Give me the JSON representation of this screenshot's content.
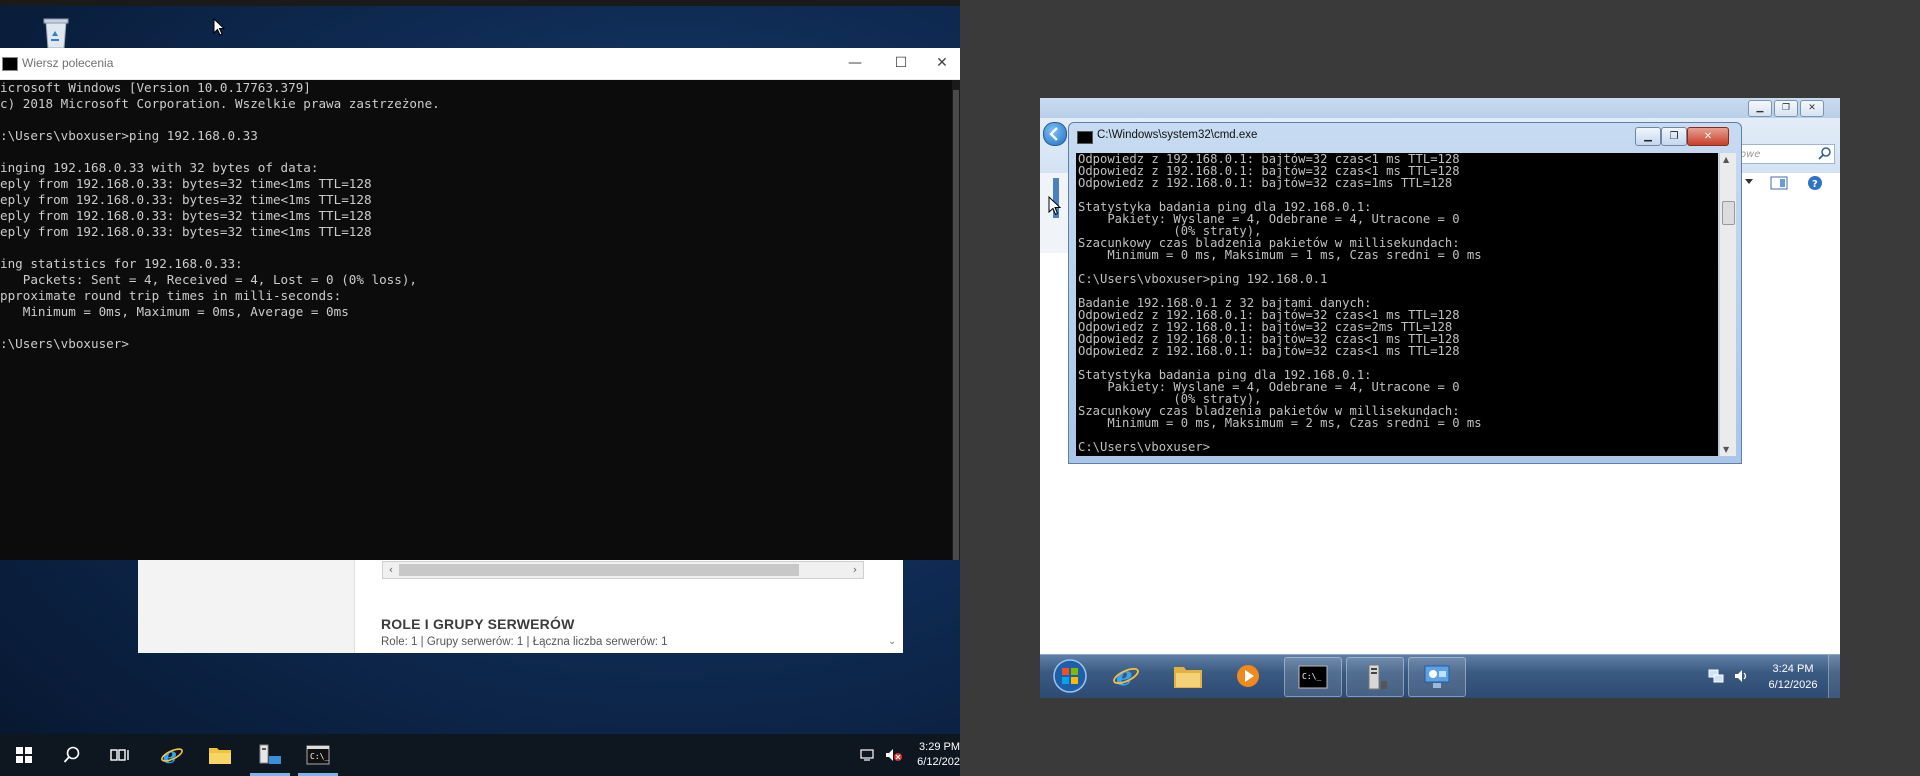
{
  "left_vm": {
    "cmd": {
      "title": "Wiersz polecenia",
      "lines": [
        "icrosoft Windows [Version 10.0.17763.379]",
        "c) 2018 Microsoft Corporation. Wszelkie prawa zastrzeżone.",
        "",
        ":\\Users\\vboxuser>ping 192.168.0.33",
        "",
        "inging 192.168.0.33 with 32 bytes of data:",
        "eply from 192.168.0.33: bytes=32 time<1ms TTL=128",
        "eply from 192.168.0.33: bytes=32 time<1ms TTL=128",
        "eply from 192.168.0.33: bytes=32 time<1ms TTL=128",
        "eply from 192.168.0.33: bytes=32 time<1ms TTL=128",
        "",
        "ing statistics for 192.168.0.33:",
        "   Packets: Sent = 4, Received = 4, Lost = 0 (0% loss),",
        "pproximate round trip times in milli-seconds:",
        "   Minimum = 0ms, Maximum = 0ms, Average = 0ms",
        "",
        ":\\Users\\vboxuser>"
      ],
      "btn_minimize": "—",
      "btn_maximize": "☐",
      "btn_close": "✕"
    },
    "server_manager": {
      "section_title": "ROLE I GRUPY SERWERÓW",
      "section_sub": "Role: 1 | Grupy serwerów: 1 | Łączna liczba serwerów: 1",
      "scroll_left": "‹",
      "scroll_right": "›",
      "chevron": "⌄"
    },
    "taskbar": {
      "time": "3:29 PM",
      "date": "6/12/202"
    }
  },
  "right_vm": {
    "explorer": {
      "search_placeholder": "owe"
    },
    "cmd": {
      "title": "C:\\Windows\\system32\\cmd.exe",
      "lines": [
        "Odpowiedz z 192.168.0.1: bajtów=32 czas<1 ms TTL=128",
        "Odpowiedz z 192.168.0.1: bajtów=32 czas<1 ms TTL=128",
        "Odpowiedz z 192.168.0.1: bajtów=32 czas=1ms TTL=128",
        "",
        "Statystyka badania ping dla 192.168.0.1:",
        "    Pakiety: Wyslane = 4, Odebrane = 4, Utracone = 0",
        "             (0% straty),",
        "Szacunkowy czas bladzenia pakietów w millisekundach:",
        "    Minimum = 0 ms, Maksimum = 1 ms, Czas sredni = 0 ms",
        "",
        "C:\\Users\\vboxuser>ping 192.168.0.1",
        "",
        "Badanie 192.168.0.1 z 32 bajtami danych:",
        "Odpowiedz z 192.168.0.1: bajtów=32 czas<1 ms TTL=128",
        "Odpowiedz z 192.168.0.1: bajtów=32 czas=2ms TTL=128",
        "Odpowiedz z 192.168.0.1: bajtów=32 czas<1 ms TTL=128",
        "Odpowiedz z 192.168.0.1: bajtów=32 czas<1 ms TTL=128",
        "",
        "Statystyka badania ping dla 192.168.0.1:",
        "    Pakiety: Wyslane = 4, Odebrane = 4, Utracone = 0",
        "             (0% straty),",
        "Szacunkowy czas bladzenia pakietów w millisekundach:",
        "    Minimum = 0 ms, Maksimum = 2 ms, Czas sredni = 0 ms",
        "",
        "C:\\Users\\vboxuser>"
      ]
    },
    "taskbar": {
      "time": "3:24 PM",
      "date": "6/12/2026"
    }
  },
  "colors": {
    "cmd_bg": "#0c0c0c",
    "cmd_text": "#cccccc",
    "win10_taskbar": "#0e1620",
    "win7_taskbar": "#3b5a82",
    "host_bg": "#3a3a3a"
  }
}
